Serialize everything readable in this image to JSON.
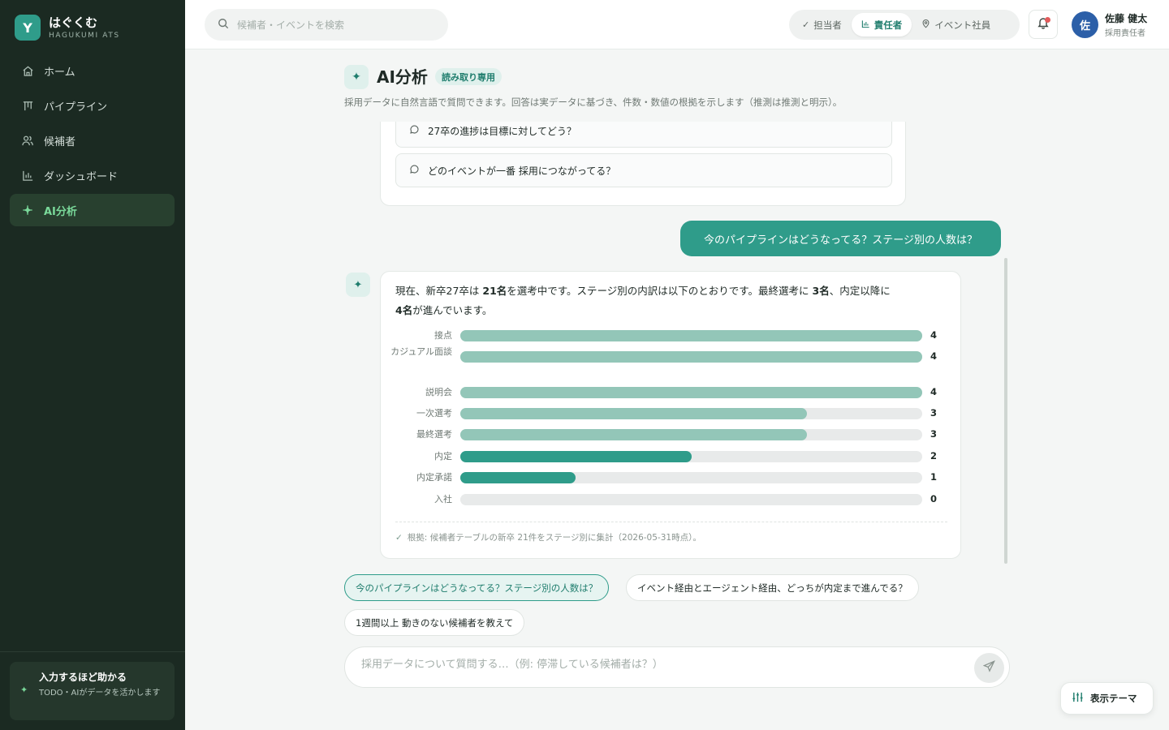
{
  "brand": {
    "logo_glyph": "Y",
    "name": "はぐくむ",
    "sub": "HAGUKUMI ATS"
  },
  "sidebar": {
    "items": [
      {
        "label": "ホーム",
        "icon": "home-icon"
      },
      {
        "label": "パイプライン",
        "icon": "pipeline-icon"
      },
      {
        "label": "候補者",
        "icon": "users-icon"
      },
      {
        "label": "ダッシュボード",
        "icon": "chart-icon"
      },
      {
        "label": "AI分析",
        "icon": "sparkle-icon",
        "active": true
      }
    ],
    "footer_card": {
      "title": "入力するほど助かる",
      "text": "TODO・AIがデータを活かします"
    }
  },
  "topbar": {
    "search_placeholder": "候補者・イベントを検索",
    "roles": [
      {
        "label": "担当者",
        "icon": "check-icon"
      },
      {
        "label": "責任者",
        "icon": "bar-chart-icon",
        "active": true
      },
      {
        "label": "イベント社員",
        "icon": "pin-icon"
      }
    ],
    "user": {
      "initial": "佐",
      "name": "佐藤 健太",
      "role": "採用責任者"
    }
  },
  "header": {
    "title": "AI分析",
    "badge": "読み取り専用",
    "description": "採用データに自然言語で質問できます。回答は実データに基づき、件数・数値の根拠を示します（推測は推測と明示）。"
  },
  "chat": {
    "suggestions": [
      "27卒の進捗は目標に対してどう？",
      "どのイベントが一番 採用につながってる？"
    ],
    "user_message": "今のパイプラインはどうなってる？ステージ別の人数は？",
    "answer": {
      "t1": "現在、新卒27卒は ",
      "b1": "21名",
      "t2": "を選考中です。ステージ別の内訳は以下のとおりです。最終選考に ",
      "b2": "3名",
      "t3": "、内定以降に",
      "b3": "4名",
      "t4": "が進んでいます。",
      "source": "根拠: 候補者テーブルの新卒 21件をステージ別に集計（2026-05-31時点）。"
    }
  },
  "chart_data": {
    "type": "bar",
    "orientation": "horizontal",
    "categories": [
      "接点",
      "カジュアル面談",
      "説明会",
      "一次選考",
      "最終選考",
      "内定",
      "内定承諾",
      "入社"
    ],
    "values": [
      4,
      4,
      4,
      3,
      3,
      2,
      1,
      0
    ],
    "xlim": [
      0,
      4
    ],
    "colors": [
      "#93c6b8",
      "#93c6b8",
      "#93c6b8",
      "#93c6b8",
      "#93c6b8",
      "#2f9c8a",
      "#2f9c8a",
      "#2f9c8a"
    ]
  },
  "prompts": [
    "今のパイプラインはどうなってる？ステージ別の人数は？",
    "イベント経由とエージェント経由、どっちが内定まで進んでる？",
    "1週間以上 動きのない候補者を教えて"
  ],
  "composer": {
    "placeholder": "採用データについて質問する…（例: 停滞している候補者は？）"
  },
  "theme_button": "表示テーマ",
  "colors": {
    "accent": "#2f9c8a",
    "sidebar_bg": "#1b2a22",
    "active_nav": "#7ad99a"
  }
}
